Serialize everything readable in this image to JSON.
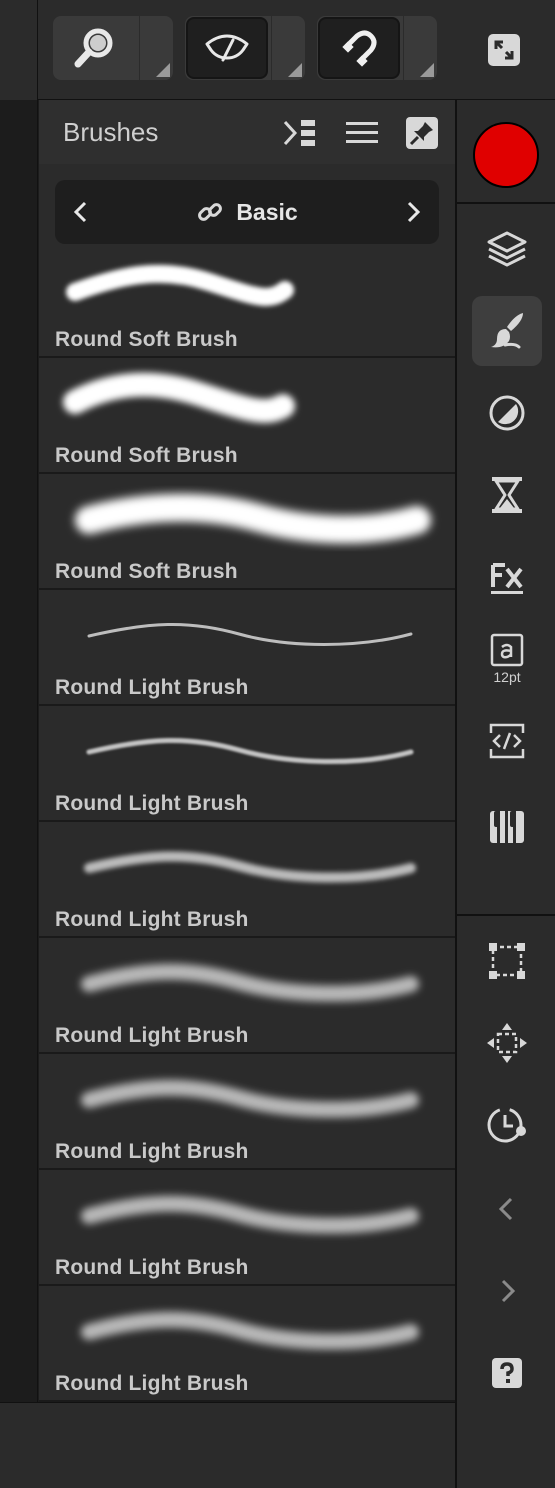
{
  "toolbar": {
    "tools": [
      {
        "icon": "zoom-icon"
      },
      {
        "icon": "view-tool-icon"
      },
      {
        "icon": "snapping-icon"
      }
    ],
    "expand_icon": "expand-icon"
  },
  "panel": {
    "title": "Brushes",
    "header_icons": [
      "sort-list-icon",
      "list-view-icon",
      "pin-icon"
    ],
    "category": {
      "label": "Basic",
      "icon": "link-icon"
    },
    "brushes": [
      {
        "name": "Round Soft Brush"
      },
      {
        "name": "Round Soft Brush"
      },
      {
        "name": "Round Soft Brush"
      },
      {
        "name": "Round Light Brush"
      },
      {
        "name": "Round Light Brush"
      },
      {
        "name": "Round Light Brush"
      },
      {
        "name": "Round Light Brush"
      },
      {
        "name": "Round Light Brush"
      },
      {
        "name": "Round Light Brush"
      },
      {
        "name": "Round Light Brush"
      }
    ]
  },
  "studio": {
    "color": "#e00000",
    "text_size_caption": "12pt",
    "buttons": [
      "layers-icon",
      "brushes-icon",
      "adjustments-icon",
      "history-icon",
      "fx-icon",
      "text-style-icon",
      "code-icon",
      "swatches-icon",
      "transform-icon",
      "move-icon",
      "time-icon",
      "chevron-left-icon",
      "chevron-right-icon",
      "help-icon"
    ]
  },
  "colors": {
    "background": "#2b2b2b",
    "panel_header": "#2f2f2f",
    "accent_red": "#e00000"
  }
}
